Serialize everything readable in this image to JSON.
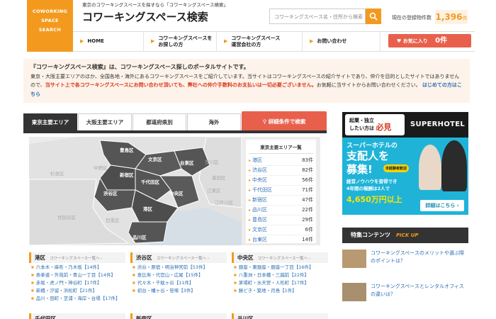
{
  "header": {
    "logo_lines": [
      "COWORKING",
      "SPACE",
      "SEARCH"
    ],
    "tagline": "東京のコワーキングスペースを探すなら「コワーキングスペース検索」",
    "site_title": "コワーキングスペース検索",
    "search_placeholder": "コワーキングスペース名・住所から検索",
    "count_label": "現在の登録物件数",
    "count_value": "1,396",
    "count_unit": "件"
  },
  "nav": {
    "items": [
      {
        "label": "HOME"
      },
      {
        "label": "コワーキングスペースを\nお探しの方"
      },
      {
        "label": "コワーキングスペース\n運営会社の方"
      },
      {
        "label": "お問い合わせ"
      }
    ],
    "favorites_label": "お気に入り",
    "favorites_count": "0件"
  },
  "intro": {
    "lead": "『コワーキングスペース検索』は、コワーキングスペース探しのポータルサイトです。",
    "body": "東京・大阪主要エリアのほか、全国各地・海外にあるコワーキングスペースをご紹介しています。当サイトはコワーキングスペースの紹介サイトであり、仲介を目的としたサイトではありませんので、",
    "warning": "当サイト上で各コワーキングスペースにお問い合わせ頂いても、弊社への仲介手数料のお支払いは一切必要ございません。",
    "tail": "お気軽に当サイトからお問い合わせください。",
    "link": "はじめての方はこちら"
  },
  "tabs": [
    {
      "label": "東京主要エリア"
    },
    {
      "label": "大阪主要エリア"
    },
    {
      "label": "都道府県別"
    },
    {
      "label": "海外"
    }
  ],
  "detail_search_label": "詳細条件で検索",
  "map": {
    "labels_active": [
      "豊島区",
      "文京区",
      "台東区",
      "新宿区",
      "千代田区",
      "中央区",
      "渋谷区",
      "港区",
      "品川区"
    ],
    "labels_dim": [
      "杉並区",
      "中野区",
      "荒川区",
      "墨田区",
      "江東区",
      "江戸川区",
      "世田谷区",
      "目黒区"
    ]
  },
  "area_list": {
    "title": "東京主要エリア一覧",
    "rows": [
      {
        "name": "港区",
        "count": "83件"
      },
      {
        "name": "渋谷区",
        "count": "82件"
      },
      {
        "name": "中央区",
        "count": "56件"
      },
      {
        "name": "千代田区",
        "count": "71件"
      },
      {
        "name": "新宿区",
        "count": "47件"
      },
      {
        "name": "品川区",
        "count": "22件"
      },
      {
        "name": "豊島区",
        "count": "29件"
      },
      {
        "name": "文京区",
        "count": "6件"
      },
      {
        "name": "台東区",
        "count": "14件"
      }
    ]
  },
  "columns": [
    {
      "title": "港区",
      "subtitle": "コワーキングスペース一覧へ ›",
      "items": [
        "六本木・麻布・乃木坂【14件】",
        "表参道・外苑前・青山一丁目【14件】",
        "赤坂・虎ノ門・神谷町【17件】",
        "新橋・汐留・浜松町【21件】",
        "品川・田町・芝浦・海岸・台場【17件】"
      ]
    },
    {
      "title": "渋谷区",
      "subtitle": "コワーキングスペース一覧へ ›",
      "items": [
        "渋谷・原宿・明治神宮前【53件】",
        "恵比寿・代官山・広尾【15件】",
        "代々木・千駄ヶ谷【11件】",
        "初台・幡ヶ谷・笹塚【3件】"
      ]
    },
    {
      "title": "中央区",
      "subtitle": "コワーキングスペース一覧へ ›",
      "items": [
        "銀座・東銀座・銀座一丁目【16件】",
        "八重洲・日本橋・三越前【22件】",
        "茅場町・水天宮・人形町【17件】",
        "勝どき・築地・月島【1件】"
      ]
    }
  ],
  "columns_row2": [
    "千代田区",
    "新宿区",
    "品川区"
  ],
  "ad": {
    "badge_line1": "起業・独立",
    "badge_line2": "したい方は",
    "badge_strong": "必見",
    "brand": "SUPERHOTEL",
    "line1": "スーパーホテルの",
    "line2": "支配人を",
    "line3": "募集!",
    "tag": "未経験者歓迎",
    "line4": "経営ノウハウを習得でき",
    "line5": "4年間の報酬は2人で",
    "line6": "4,650万円以上",
    "cta": "詳細はこちら ›"
  },
  "special": {
    "title": "特集コンテンツ",
    "pickup": "PICK UP",
    "items": [
      {
        "text": "コワーキングスペースのメリットや選ぶ際のポイントは？"
      },
      {
        "text": "コワーキングスペースとレンタルオフィスの違いは？"
      }
    ]
  },
  "colors": {
    "accent": "#f39a1e",
    "cta_red": "#e8604c",
    "link": "#2a6db5",
    "dark": "#333333"
  }
}
